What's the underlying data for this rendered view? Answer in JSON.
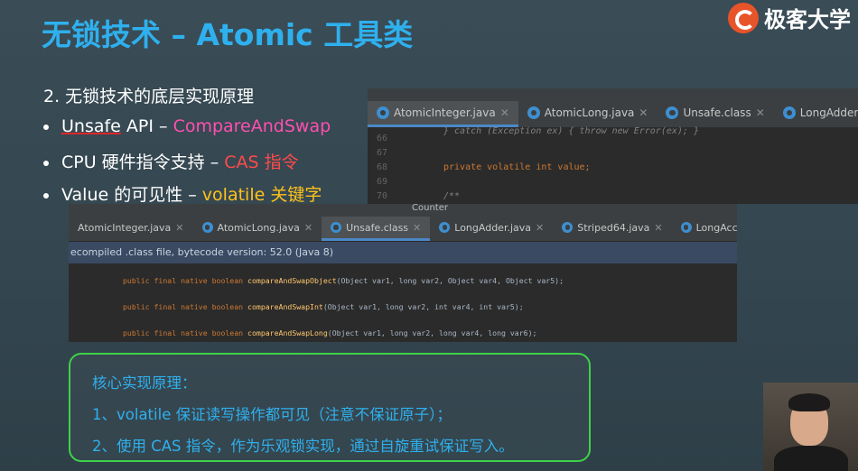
{
  "title": "无锁技术 – Atomic 工具类",
  "logo": {
    "text": "极客大学",
    "icon": "geekbang-logo-icon"
  },
  "bullets": {
    "heading": "2. 无锁技术的底层实现原理",
    "b1_pre": "Unsafe",
    "b1_mid": " API – ",
    "b1_hl": "CompareAndSwap",
    "b2_pre": "CPU 硬件指令支持 – ",
    "b2_hl": "CAS 指令",
    "b3_pre": "Value 的可见性 – ",
    "b3_hl": "volatile 关键字"
  },
  "ide_top": {
    "tabs": [
      "AtomicInteger.java",
      "AtomicLong.java",
      "Unsafe.class",
      "LongAdder"
    ],
    "lines": [
      {
        "n": "66",
        "text": "} catch (Exception ex) { throw new Error(ex); }"
      },
      {
        "n": "67",
        "text": ""
      },
      {
        "n": "68",
        "text": "private volatile int value;"
      },
      {
        "n": "69",
        "text": ""
      },
      {
        "n": "70",
        "text": "/**"
      }
    ]
  },
  "ide_bottom": {
    "tabs": [
      "AtomicInteger.java",
      "AtomicLong.java",
      "Unsafe.class",
      "LongAdder.java",
      "Striped64.java",
      "LongAccumulator.java"
    ],
    "toolbar_counter": "Counter",
    "decompiled_note": "ecompiled .class file, bytecode version: 52.0 (Java 8)",
    "lines": [
      {
        "mods": "public final native boolean ",
        "fn": "compareAndSwapObject",
        "args": "(Object var1, long var2, Object var4, Object var5);"
      },
      {
        "mods": "public final native boolean ",
        "fn": "compareAndSwapInt",
        "args": "(Object var1, long var2, int var4, int var5);"
      },
      {
        "mods": "public final native boolean ",
        "fn": "compareAndSwapLong",
        "args": "(Object var1, long var2, long var4, long var6);"
      }
    ]
  },
  "summary": {
    "title": "核心实现原理：",
    "line1": "1、volatile 保证读写操作都可见（注意不保证原子）；",
    "line2": "2、使用 CAS 指令，作为乐观锁实现，通过自旋重试保证写入。"
  },
  "colors": {
    "title": "#2fb0ee",
    "pink": "#ff4fb0",
    "red": "#ff4a4a",
    "yellow": "#ffc21a",
    "box_border": "#3fd14a"
  }
}
